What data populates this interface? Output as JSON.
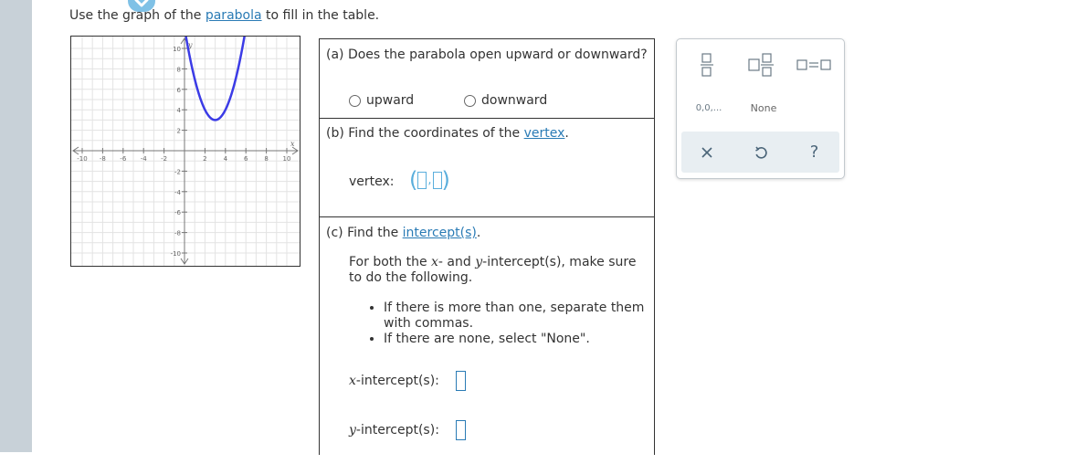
{
  "prompt": {
    "before": "Use the ",
    "graph_word": "graph",
    "middle": " of the ",
    "link": "parabola",
    "after": " to fill in the table."
  },
  "graph": {
    "x_axis_label": "x",
    "y_axis_label": "y",
    "x_ticks": [
      "-10",
      "-8",
      "-6",
      "-4",
      "-2",
      "2",
      "4",
      "6",
      "8",
      "10"
    ],
    "y_ticks": [
      "10",
      "8",
      "6",
      "4",
      "2",
      "-2",
      "-4",
      "-6",
      "-8",
      "-10"
    ],
    "xlim": [
      -10,
      10
    ],
    "ylim": [
      -10,
      10
    ],
    "curve_color": "#3b3be6",
    "vertex": [
      3,
      3
    ],
    "a": 1
  },
  "part_a": {
    "question": "(a) Does the parabola open upward or downward?",
    "option_up": "upward",
    "option_down": "downward"
  },
  "part_b": {
    "question_before": "(b) Find the coordinates of the ",
    "question_link": "vertex",
    "question_after": ".",
    "vertex_label": "vertex:",
    "open_paren": "(",
    "comma": ",",
    "close_paren": ")"
  },
  "part_c": {
    "question_before": "(c) Find the ",
    "question_link": "intercept(s)",
    "question_after": ".",
    "instruction_1": "For both the ",
    "instruction_x": "x",
    "instruction_2": "- and ",
    "instruction_y": "y",
    "instruction_3": "-intercept(s), make sure to do the following.",
    "bullet_1": "If there is more than one, separate them with commas.",
    "bullet_2": "If there are none, select \"None\".",
    "x_var": "x",
    "x_label": "-intercept(s):",
    "y_var": "y",
    "y_label": "-intercept(s):"
  },
  "toolbar": {
    "list_label": "0,0,...",
    "none_label": "None",
    "help_label": "?"
  },
  "colors": {
    "accent": "#2a7bb5",
    "input_blue": "#5aaedc",
    "sidebar": "#c8d1d8"
  }
}
